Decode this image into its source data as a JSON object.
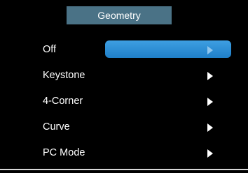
{
  "menu": {
    "title": "Geometry",
    "items": [
      {
        "label": "Off"
      },
      {
        "label": "Keystone"
      },
      {
        "label": "4-Corner"
      },
      {
        "label": "Curve"
      },
      {
        "label": "PC Mode"
      }
    ],
    "selected_item": "Off",
    "highlight_color": "#2b8fd9",
    "title_bar_color": "#4a7286",
    "arrow_icon": "triangle-right-icon"
  }
}
